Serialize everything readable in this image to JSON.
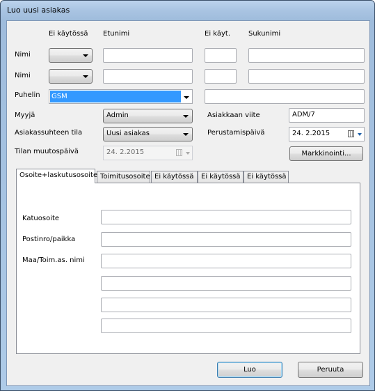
{
  "window": {
    "title": "Luo uusi asiakas"
  },
  "columns": {
    "ei_kaytossa": "Ei käytössä",
    "etunimi": "Etunimi",
    "ei_kayt": "Ei käyt.",
    "sukunimi": "Sukunimi"
  },
  "rows": {
    "nimi1_label": "Nimi",
    "nimi2_label": "Nimi",
    "puhelin_label": "Puhelin",
    "puhelin_type": "GSM",
    "puhelin_value": ""
  },
  "fields": {
    "myyja_label": "Myyjä",
    "myyja_value": "Admin",
    "asiakkaan_viite_label": "Asiakkaan viite",
    "asiakkaan_viite_value": "ADM/7",
    "asiakassuhteen_tila_label": "Asiakassuhteen tila",
    "asiakassuhteen_tila_value": "Uusi asiakas",
    "perustamispaiva_label": "Perustamispäivä",
    "perustamispaiva_value": "24.  2.2015",
    "tilan_muutospaiva_label": "Tilan muutospäivä",
    "tilan_muutospaiva_value": "24.  2.2015",
    "markkinointi_button": "Markkinointi..."
  },
  "tabs": [
    {
      "label": "Osoite+laskutusosoite",
      "active": true
    },
    {
      "label": "Toimitusosoite",
      "active": false
    },
    {
      "label": "Ei käytössä",
      "active": false
    },
    {
      "label": "Ei käytössä",
      "active": false
    },
    {
      "label": "Ei käytössä",
      "active": false
    }
  ],
  "address": {
    "katuosoite_label": "Katuosoite",
    "postinro_label": "Postinro/paikka",
    "maa_label": "Maa/Toim.as. nimi"
  },
  "buttons": {
    "luo": "Luo",
    "peruuta": "Peruuta"
  }
}
